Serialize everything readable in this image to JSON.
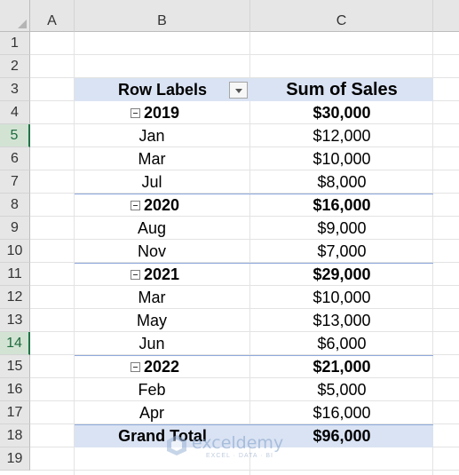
{
  "columns": [
    {
      "label": "A"
    },
    {
      "label": "B"
    },
    {
      "label": "C"
    }
  ],
  "rows": [
    "1",
    "2",
    "3",
    "4",
    "5",
    "6",
    "7",
    "8",
    "9",
    "10",
    "11",
    "12",
    "13",
    "14",
    "15",
    "16",
    "17",
    "18",
    "19"
  ],
  "active_rows": [
    "5",
    "14"
  ],
  "pivot": {
    "header_row_labels": "Row Labels",
    "header_sum": "Sum of Sales",
    "groups": [
      {
        "year": "2019",
        "total": "$30,000",
        "items": [
          {
            "month": "Jan",
            "sales": "$12,000"
          },
          {
            "month": "Mar",
            "sales": "$10,000"
          },
          {
            "month": "Jul",
            "sales": "$8,000"
          }
        ]
      },
      {
        "year": "2020",
        "total": "$16,000",
        "items": [
          {
            "month": "Aug",
            "sales": "$9,000"
          },
          {
            "month": "Nov",
            "sales": "$7,000"
          }
        ]
      },
      {
        "year": "2021",
        "total": "$29,000",
        "items": [
          {
            "month": "Mar",
            "sales": "$10,000"
          },
          {
            "month": "May",
            "sales": "$13,000"
          },
          {
            "month": "Jun",
            "sales": "$6,000"
          }
        ]
      },
      {
        "year": "2022",
        "total": "$21,000",
        "items": [
          {
            "month": "Feb",
            "sales": "$5,000"
          },
          {
            "month": "Apr",
            "sales": "$16,000"
          }
        ]
      }
    ],
    "grand_total_label": "Grand Total",
    "grand_total_value": "$96,000"
  },
  "watermark": {
    "name": "exceldemy",
    "tagline": "EXCEL · DATA · BI"
  }
}
